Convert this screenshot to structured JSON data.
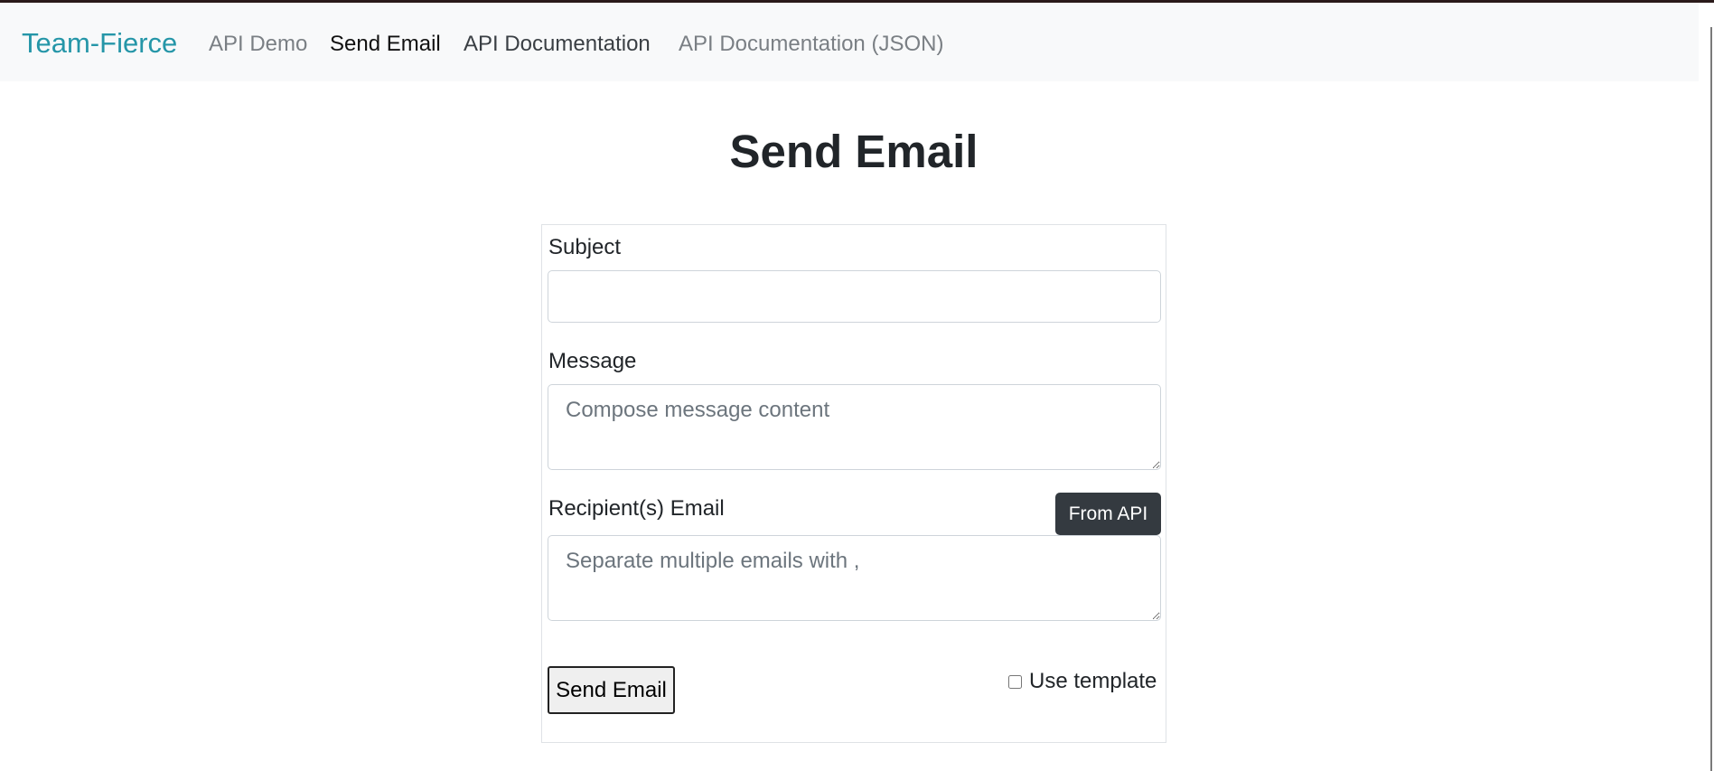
{
  "navbar": {
    "brand": "Team-Fierce",
    "links": [
      {
        "label": "API Demo"
      },
      {
        "label": "Send Email"
      },
      {
        "label": "API Documentation"
      },
      {
        "label": "API Documentation (JSON)"
      }
    ],
    "active": "Send Email"
  },
  "page": {
    "title": "Send Email"
  },
  "form": {
    "subject": {
      "label": "Subject",
      "value": "",
      "placeholder": ""
    },
    "message": {
      "label": "Message",
      "value": "",
      "placeholder": "Compose message content"
    },
    "recipients": {
      "label": "Recipient(s) Email",
      "value": "",
      "placeholder": "Separate multiple emails with ,"
    },
    "from_api_label": "From API",
    "send_label": "Send Email",
    "use_template": {
      "label": "Use template",
      "checked": false
    }
  },
  "colors": {
    "brand": "#2596a8",
    "navbar_bg": "#f8f9fa",
    "dark_button": "#343a40",
    "text": "#212529"
  }
}
